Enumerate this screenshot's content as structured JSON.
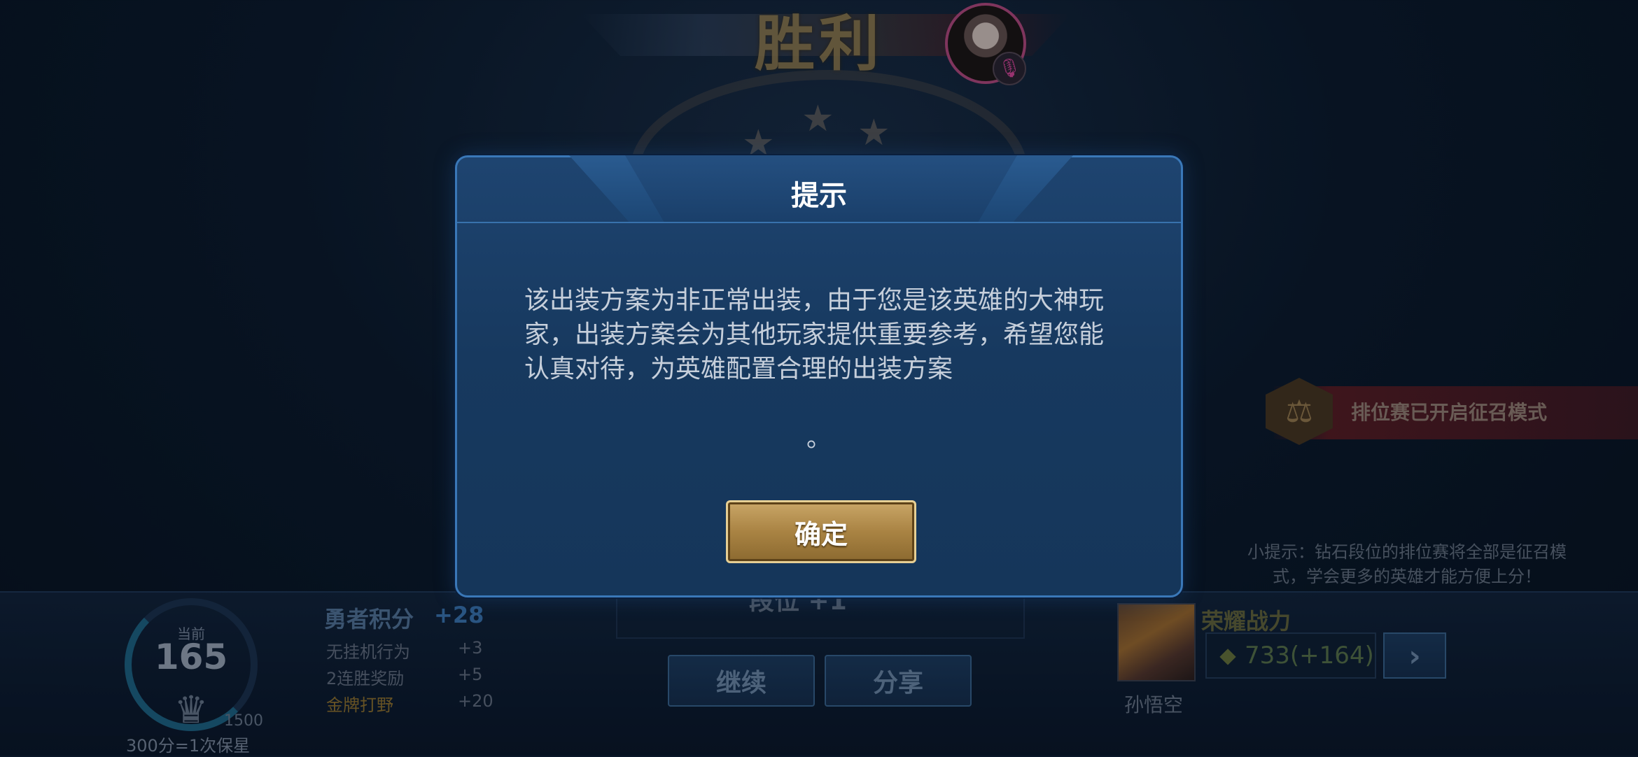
{
  "background": {
    "victory_title": "胜利",
    "mode_banner": "排位赛已开启征召模式",
    "tip": "小提示：钻石段位的排位赛将全部是征召模式，学会更多的英雄才能方便上分！",
    "rank": {
      "current_label": "当前",
      "value": "165",
      "max": "1500",
      "shield_rule": "300分=1次保星"
    },
    "brave_points": {
      "title": "勇者积分",
      "total": "+28",
      "rows": [
        {
          "label": "无挂机行为",
          "value": "+3"
        },
        {
          "label": "2连胜奖励",
          "value": "+5"
        },
        {
          "label": "金牌打野",
          "value": "+20"
        }
      ]
    },
    "duan_text": "段位 +1",
    "continue_label": "继续",
    "share_label": "分享",
    "hero_name": "孙悟空",
    "honor_title": "荣耀战力",
    "honor_power": "733(+164)"
  },
  "modal": {
    "title": "提示",
    "message": "该出装方案为非正常出装，由于您是该英雄的大神玩家，出装方案会为其他玩家提供重要参考，希望您能认真对待，为英雄配置合理的出装方案",
    "message_end": "。",
    "confirm_label": "确定"
  },
  "colors": {
    "modal_border": "#3a78b8",
    "confirm_gold": "#c9a667",
    "mic_pink": "#e64aa1"
  },
  "icons": {
    "mic": "microphone-icon",
    "star": "star-icon",
    "scale": "scale-icon",
    "arrow": "chevron-right-icon"
  }
}
